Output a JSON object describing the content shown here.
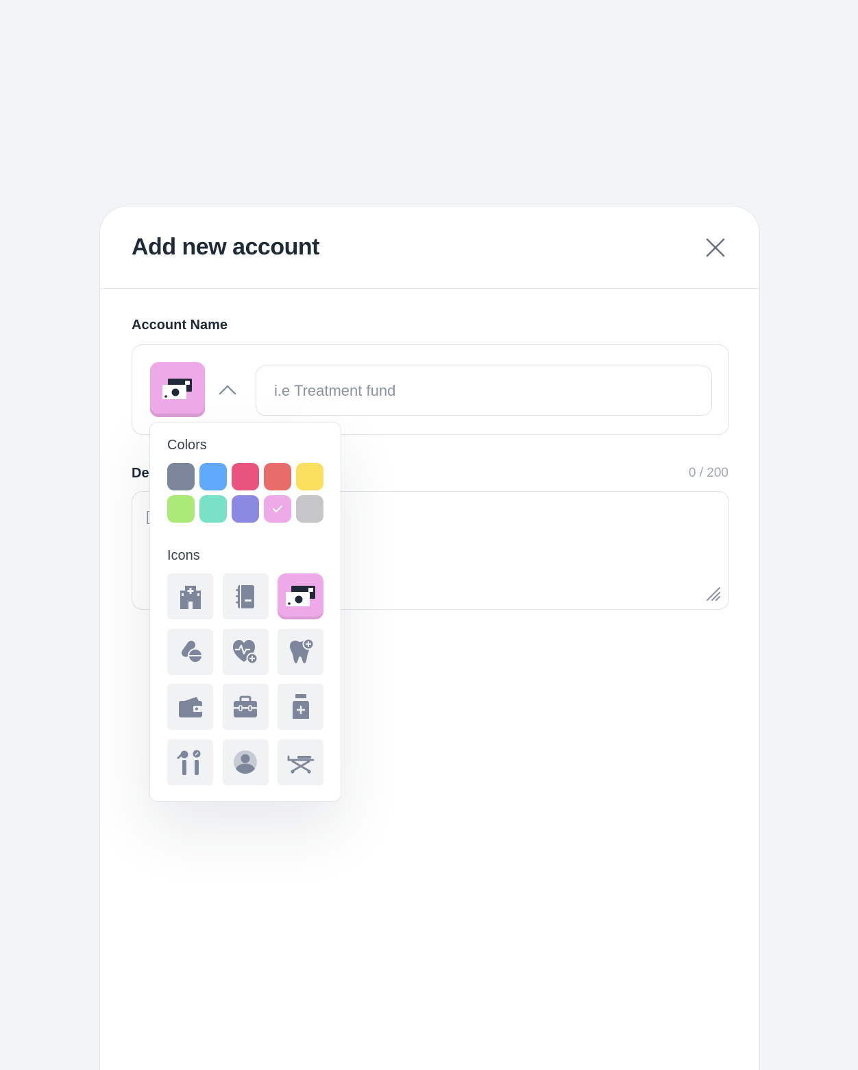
{
  "modal": {
    "title": "Add new account"
  },
  "account_name": {
    "label": "Account Name",
    "placeholder": "i.e Treatment fund",
    "value": "",
    "selected_icon": "money-icon",
    "selected_color": "#eeaae8"
  },
  "description": {
    "label": "Des",
    "counter": "0 / 200",
    "placeholder": "["
  },
  "picker": {
    "colors_heading": "Colors",
    "icons_heading": "Icons",
    "colors": [
      {
        "name": "slate",
        "hex": "#7e869b"
      },
      {
        "name": "blue",
        "hex": "#5ea9fb"
      },
      {
        "name": "pink",
        "hex": "#e9547f"
      },
      {
        "name": "salmon",
        "hex": "#e86d6a"
      },
      {
        "name": "yellow",
        "hex": "#fbe060"
      },
      {
        "name": "green",
        "hex": "#acea78"
      },
      {
        "name": "teal",
        "hex": "#79e1c5"
      },
      {
        "name": "purple",
        "hex": "#8c89e2"
      },
      {
        "name": "lilac",
        "hex": "#eeaae8",
        "selected": true
      },
      {
        "name": "gray",
        "hex": "#c6c6c8"
      }
    ],
    "icons": [
      {
        "name": "hospital-icon"
      },
      {
        "name": "notebook-icon"
      },
      {
        "name": "money-icon",
        "selected": true
      },
      {
        "name": "pills-icon"
      },
      {
        "name": "heart-health-icon"
      },
      {
        "name": "tooth-icon"
      },
      {
        "name": "wallet-icon"
      },
      {
        "name": "briefcase-icon"
      },
      {
        "name": "medicine-bottle-icon"
      },
      {
        "name": "dental-tools-icon"
      },
      {
        "name": "person-icon"
      },
      {
        "name": "stretcher-icon"
      }
    ]
  }
}
